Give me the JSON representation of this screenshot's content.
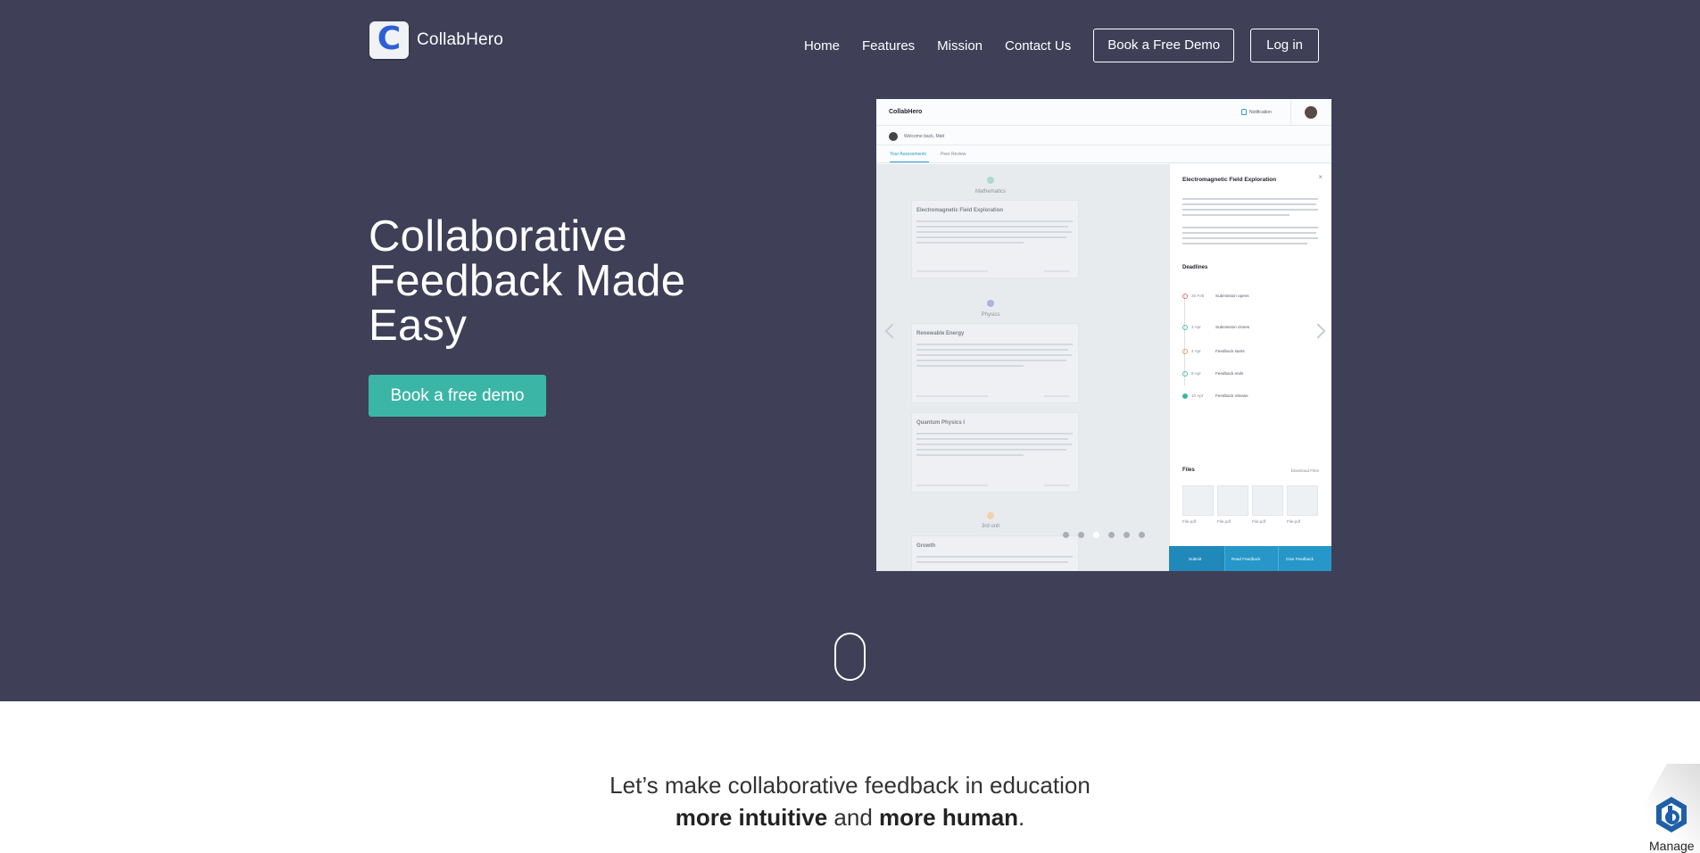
{
  "brand": {
    "name": "CollabHero",
    "logo_letter": "C"
  },
  "nav": {
    "links": [
      "Home",
      "Features",
      "Mission",
      "Contact Us"
    ],
    "demo_button": "Book a Free Demo",
    "login_button": "Log in"
  },
  "hero": {
    "title": "Collaborative Feedback Made Easy",
    "cta": "Book a free demo"
  },
  "mockup": {
    "app_name": "CollabHero",
    "notification_label": "Notification",
    "welcome": "Welcome back, Matt",
    "tabs": [
      "Your Assessments",
      "Peer Review"
    ],
    "subjects": [
      "Mathematics",
      "Physics",
      "3rd unit"
    ],
    "cards": [
      "Electromagnetic Field Exploration",
      "Renewable Energy",
      "Quantum Physics I",
      "Growth"
    ],
    "panel": {
      "title": "Electromagnetic Field Exploration",
      "close": "×",
      "deadlines_heading": "Deadlines",
      "deadlines": [
        {
          "date": "26 Feb",
          "label": "Submission opens",
          "color": "#e57373"
        },
        {
          "date": "3 Apr",
          "label": "Submission closes",
          "color": "#4dc0b5"
        },
        {
          "date": "4 Apr",
          "label": "Feedback starts",
          "color": "#f0a050"
        },
        {
          "date": "8 Apr",
          "label": "Feedback ends",
          "color": "#4dc0b5"
        },
        {
          "date": "10 Apr",
          "label": "Feedback release",
          "color": "#3bb6a6"
        }
      ],
      "files_heading": "Files",
      "download_link": "Download Files",
      "files": [
        "File.pdf",
        "File.pdf",
        "File.pdf",
        "File.pdf"
      ],
      "actions": [
        "Submit",
        "Read Feedback",
        "Give Feedback"
      ]
    },
    "pager_count": 6,
    "pager_active": 3
  },
  "tagline": {
    "line1": "Let’s make collaborative feedback in education",
    "bold1": "more intuitive",
    "middle": " and ",
    "bold2": "more human",
    "end": "."
  },
  "manage_widget": {
    "label": "Manage"
  },
  "colors": {
    "hero_bg": "#3f3f57",
    "accent": "#3bb6a6",
    "app_blue": "#2797c9"
  }
}
